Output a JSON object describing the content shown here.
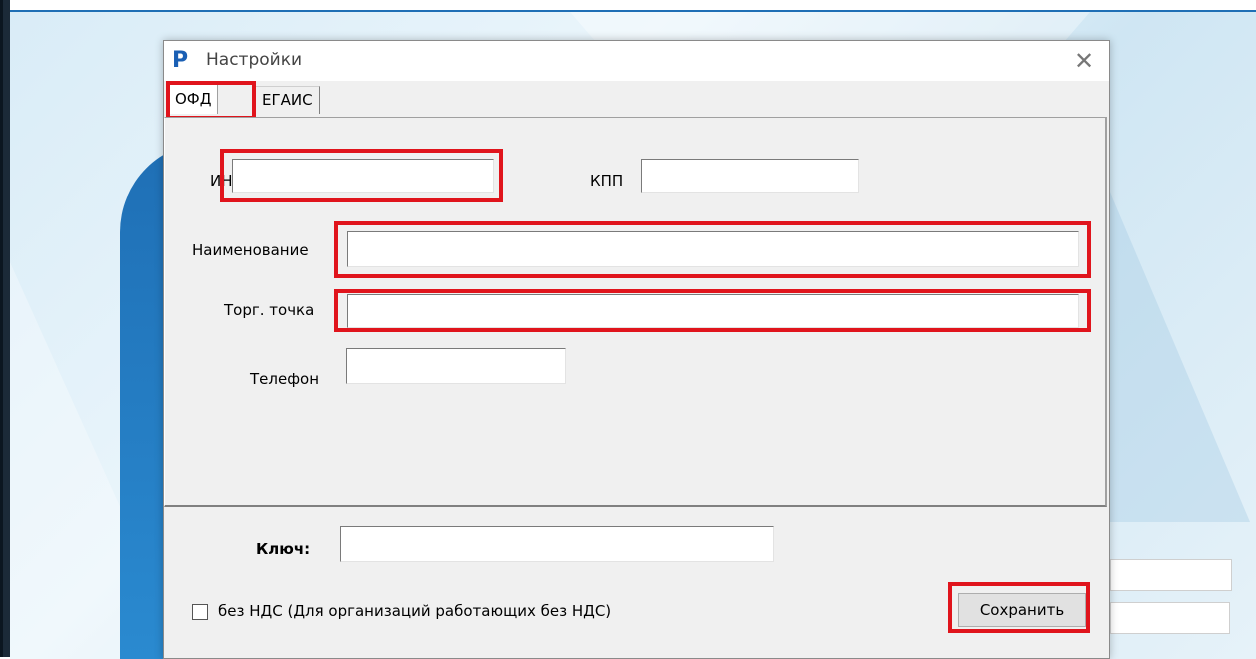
{
  "dialog": {
    "title": "Настройки",
    "app_icon_glyph": "P",
    "close_glyph": "✕"
  },
  "tabs": [
    {
      "label": "ОФД",
      "active": true
    },
    {
      "label": "ЕГАИС",
      "active": false
    }
  ],
  "ofd": {
    "inn_label": "ИНН",
    "inn_value": "",
    "kpp_label": "КПП",
    "kpp_value": "",
    "name_label": "Наименование",
    "name_value": "",
    "outlet_label": "Торг. точка",
    "outlet_value": "",
    "phone_label": "Телефон",
    "phone_value": ""
  },
  "footer": {
    "key_label": "Ключ:",
    "key_value": "",
    "no_vat_label": "без НДС (Для организаций работающих без НДС)",
    "no_vat_checked": false,
    "save_label": "Сохранить"
  },
  "colors": {
    "highlight": "#e0141c",
    "brand": "#1a5fb4"
  }
}
